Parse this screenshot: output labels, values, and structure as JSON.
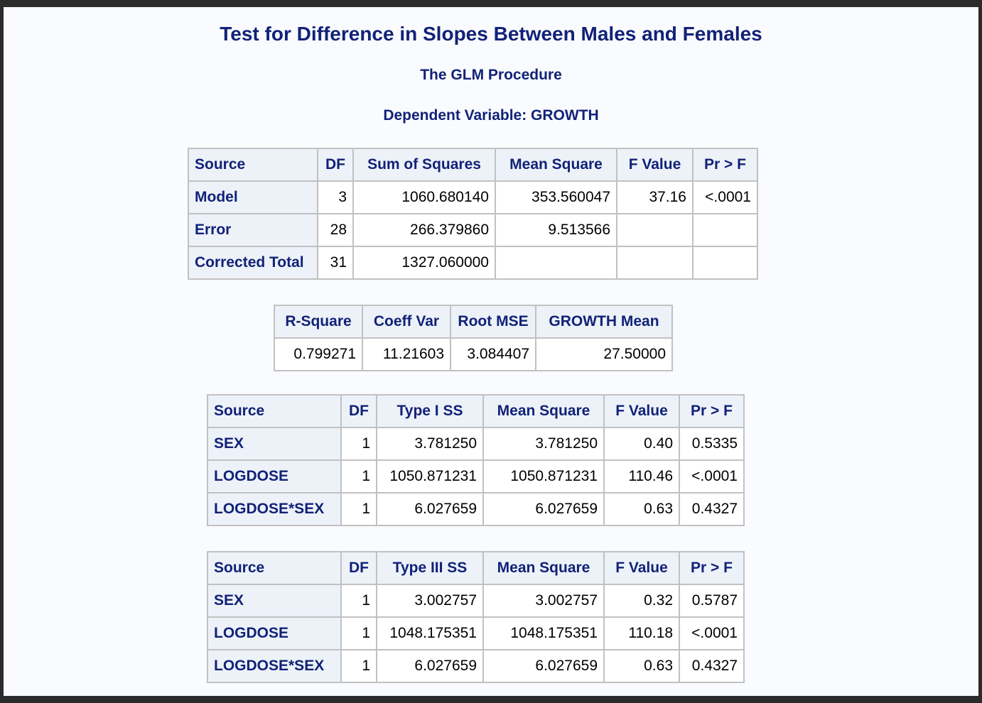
{
  "titles": {
    "main": "Test for Difference in Slopes Between Males and Females",
    "procedure": "The GLM Procedure",
    "dependent": "Dependent Variable: GROWTH"
  },
  "anova": {
    "headers": [
      "Source",
      "DF",
      "Sum of Squares",
      "Mean Square",
      "F Value",
      "Pr > F"
    ],
    "rows": [
      {
        "source": "Model",
        "df": "3",
        "ss": "1060.680140",
        "ms": "353.560047",
        "f": "37.16",
        "p": "<.0001"
      },
      {
        "source": "Error",
        "df": "28",
        "ss": "266.379860",
        "ms": "9.513566",
        "f": "",
        "p": ""
      },
      {
        "source": "Corrected Total",
        "df": "31",
        "ss": "1327.060000",
        "ms": "",
        "f": "",
        "p": ""
      }
    ]
  },
  "fit": {
    "headers": [
      "R-Square",
      "Coeff Var",
      "Root MSE",
      "GROWTH Mean"
    ],
    "values": [
      "0.799271",
      "11.21603",
      "3.084407",
      "27.50000"
    ]
  },
  "type1": {
    "headers": [
      "Source",
      "DF",
      "Type I SS",
      "Mean Square",
      "F Value",
      "Pr > F"
    ],
    "rows": [
      {
        "source": "SEX",
        "df": "1",
        "ss": "3.781250",
        "ms": "3.781250",
        "f": "0.40",
        "p": "0.5335"
      },
      {
        "source": "LOGDOSE",
        "df": "1",
        "ss": "1050.871231",
        "ms": "1050.871231",
        "f": "110.46",
        "p": "<.0001"
      },
      {
        "source": "LOGDOSE*SEX",
        "df": "1",
        "ss": "6.027659",
        "ms": "6.027659",
        "f": "0.63",
        "p": "0.4327"
      }
    ]
  },
  "type3": {
    "headers": [
      "Source",
      "DF",
      "Type III SS",
      "Mean Square",
      "F Value",
      "Pr > F"
    ],
    "rows": [
      {
        "source": "SEX",
        "df": "1",
        "ss": "3.002757",
        "ms": "3.002757",
        "f": "0.32",
        "p": "0.5787"
      },
      {
        "source": "LOGDOSE",
        "df": "1",
        "ss": "1048.175351",
        "ms": "1048.175351",
        "f": "110.18",
        "p": "<.0001"
      },
      {
        "source": "LOGDOSE*SEX",
        "df": "1",
        "ss": "6.027659",
        "ms": "6.027659",
        "f": "0.63",
        "p": "0.4327"
      }
    ]
  }
}
